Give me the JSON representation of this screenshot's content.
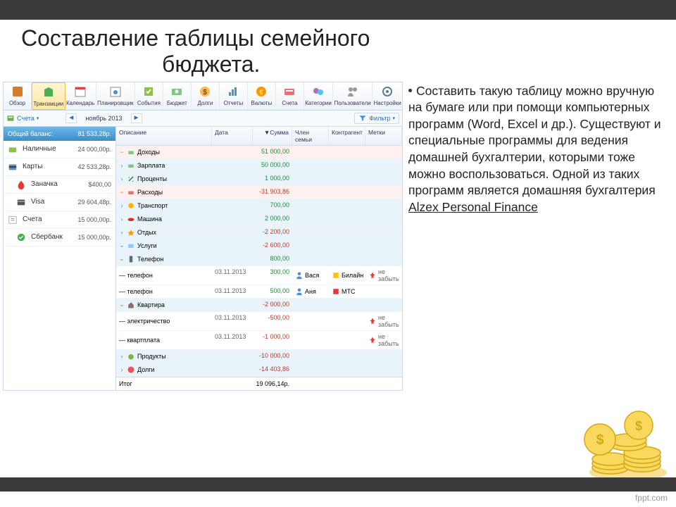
{
  "slide": {
    "title_l1": "Составление таблицы семейного",
    "title_l2": "бюджета."
  },
  "article": {
    "text": "Составить такую таблицу можно вручную на бумаге или при помощи компьютерных программ (Word, Excel и др.). Существуют и специальные программы для ведения домашней бухгалтерии, которыми тоже можно воспользоваться. Одной из таких программ является домашняя бухгалтерия ",
    "link": "Alzex Personal Finance"
  },
  "toolbar": [
    {
      "label": "Обзор"
    },
    {
      "label": "Транзакции"
    },
    {
      "label": "Календарь"
    },
    {
      "label": "Планировщик"
    },
    {
      "label": "События"
    },
    {
      "label": "Бюджет"
    },
    {
      "label": "Долги"
    },
    {
      "label": "Отчеты"
    },
    {
      "label": "Валюты"
    },
    {
      "label": "Счета"
    },
    {
      "label": "Категории"
    },
    {
      "label": "Пользователи"
    },
    {
      "label": "Настройки"
    }
  ],
  "subbar": {
    "accounts": "Счета",
    "month": "ноябрь 2013",
    "filter": "Фильтр"
  },
  "sidebar": {
    "head_label": "Общий баланс:",
    "head_value": "81 533,28р.",
    "items": [
      {
        "label": "Наличные",
        "value": "24 000,00р.",
        "level": 1
      },
      {
        "label": "Карты",
        "value": "42 533,28р.",
        "level": 1
      },
      {
        "label": "Заначка",
        "value": "$400,00",
        "level": 2
      },
      {
        "label": "Visa",
        "value": "29 604,48р.",
        "level": 2
      },
      {
        "label": "Счета",
        "value": "15 000,00р.",
        "level": 1
      },
      {
        "label": "Сбербанк",
        "value": "15 000,00р.",
        "level": 2
      }
    ]
  },
  "columns": {
    "desc": "Описание",
    "date": "Дата",
    "sum": "▼Сумма",
    "mem": "Член семьи",
    "agent": "Контрагент",
    "tag": "Метки"
  },
  "rows": [
    {
      "t": "income",
      "exp": "−",
      "desc": "Доходы",
      "sum": "51 000,00",
      "neg": false
    },
    {
      "t": "inc-sub",
      "exp": "›",
      "desc": "Зарплата",
      "sum": "50 000,00",
      "neg": false
    },
    {
      "t": "inc-sub",
      "exp": "›",
      "desc": "Проценты",
      "sum": "1 000,00",
      "neg": false
    },
    {
      "t": "expense",
      "exp": "−",
      "desc": "Расходы",
      "sum": "-31 903,86",
      "neg": true
    },
    {
      "t": "exp-sub",
      "exp": "›",
      "desc": "Транспорт",
      "sum": "700,00",
      "neg": false,
      "ind": 1
    },
    {
      "t": "exp-sub",
      "exp": "›",
      "desc": "Машина",
      "sum": "2 000,00",
      "neg": false,
      "ind": 1
    },
    {
      "t": "exp-sub",
      "exp": "›",
      "desc": "Отдых",
      "sum": "-2 200,00",
      "neg": true,
      "ind": 1
    },
    {
      "t": "exp-sub",
      "exp": "⌄",
      "desc": "Услуги",
      "sum": "-2 600,00",
      "neg": true,
      "ind": 1
    },
    {
      "t": "exp-sub2",
      "exp": "⌄",
      "desc": "Телефон",
      "sum": "800,00",
      "neg": false,
      "ind": 2
    },
    {
      "t": "leaf",
      "desc": "— телефон",
      "date": "03.11.2013",
      "sum": "300,00",
      "neg": false,
      "mem": "Вася",
      "agent": "Билайн",
      "tag": "не забыть",
      "ind": 3
    },
    {
      "t": "leaf",
      "desc": "— телефон",
      "date": "03.11.2013",
      "sum": "500,00",
      "neg": false,
      "mem": "Аня",
      "agent": "МТС",
      "tag": "",
      "ind": 3
    },
    {
      "t": "exp-sub2",
      "exp": "⌄",
      "desc": "Квартира",
      "sum": "-2 000,00",
      "neg": true,
      "ind": 2
    },
    {
      "t": "leaf",
      "desc": "— электричество",
      "date": "03.11.2013",
      "sum": "-500,00",
      "neg": true,
      "tag": "не забыть",
      "ind": 3
    },
    {
      "t": "leaf",
      "desc": "— квартплата",
      "date": "03.11.2013",
      "sum": "-1 000,00",
      "neg": true,
      "tag": "не забыть",
      "ind": 3
    },
    {
      "t": "exp-sub",
      "exp": "›",
      "desc": "Продукты",
      "sum": "-10 000,00",
      "neg": true,
      "ind": 1
    },
    {
      "t": "exp-sub",
      "exp": "›",
      "desc": "Долги",
      "sum": "-14 403,86",
      "neg": true,
      "ind": 1
    }
  ],
  "total": {
    "label": "Итог",
    "value": "19 096,14р."
  },
  "footer": "fppt.com"
}
